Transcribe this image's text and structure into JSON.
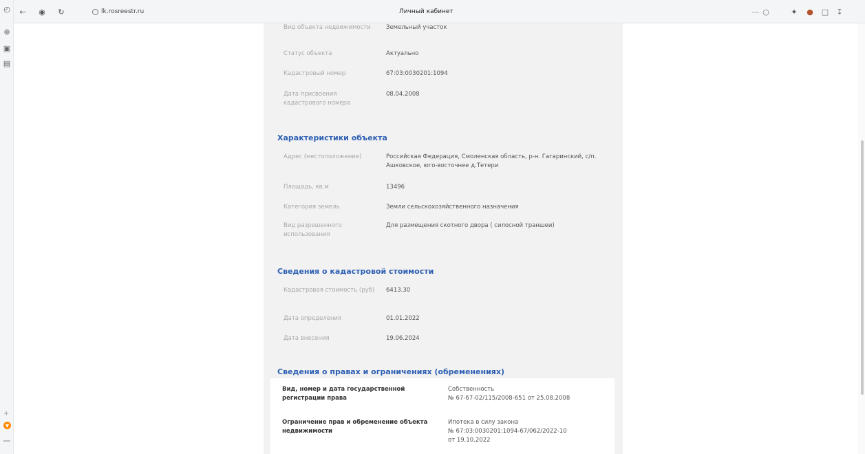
{
  "browser": {
    "url": "lk.rosreestr.ru",
    "page_title": "Личный кабинет"
  },
  "object_info": [
    {
      "label": "Вид объекта недвижимости",
      "value": "Земельный участок"
    },
    {
      "label": "Статус объекта",
      "value": "Актуально"
    },
    {
      "label": "Кадастровый номер",
      "value": "67:03:0030201:1094"
    },
    {
      "label": "Дата присвоения кадастрового номера",
      "value": "08.04.2008"
    }
  ],
  "characteristics": {
    "title": "Характеристики объекта",
    "rows": [
      {
        "label": "Адрес (местоположение)",
        "value": "Российская Федерация, Смоленская область, р-н. Гагаринский, с/п. Ашковское, юго-восточнее д.Тетери"
      },
      {
        "label": "Площадь, кв.м",
        "value": "13496"
      },
      {
        "label": "Категория земель",
        "value": "Земли сельскохозяйственного назначения"
      },
      {
        "label": "Вид разрешенного использования",
        "value": "Для размещения скотного двора ( силосной траншеи)"
      }
    ]
  },
  "cadastral_value": {
    "title": "Сведения о кадастровой стоимости",
    "rows": [
      {
        "label": "Кадастровая стоимость (руб)",
        "value": "6413.30"
      },
      {
        "label": "Дата определения",
        "value": "01.01.2022"
      },
      {
        "label": "Дата внесения",
        "value": "19.06.2024"
      }
    ]
  },
  "rights": {
    "title": "Сведения о правах и ограничениях (обременениях)",
    "rows": [
      {
        "label": "Вид, номер и дата государственной регистрации права",
        "value_line1": "Собственность",
        "value_line2": "№ 67-67-02/115/2008-651 от 25.08.2008",
        "value_line3": ""
      },
      {
        "label": "Ограничение прав и обременение объекта недвижимости",
        "value_line1": "Ипотека в силу закона",
        "value_line2": "№ 67:03:0030201:1094-67/062/2022-10",
        "value_line3": "от 19.10.2022"
      }
    ]
  },
  "colors": {
    "section_heading": "#2d5fb2",
    "panel_bg": "#f2f2f3"
  }
}
